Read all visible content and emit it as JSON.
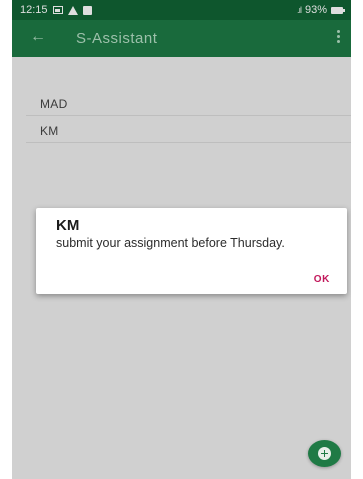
{
  "status_bar": {
    "time": "12:15",
    "left_icons": [
      "image-icon",
      "warning-icon",
      "message-icon"
    ],
    "signal": ".ıl",
    "battery_text": "93%"
  },
  "app_bar": {
    "back_icon": "arrow-back-icon",
    "title": "S-Assistant",
    "overflow_icon": "more-vert-icon"
  },
  "list": {
    "items": [
      {
        "label": "MAD"
      },
      {
        "label": "KM"
      }
    ]
  },
  "dialog": {
    "title": "KM",
    "message": "submit your assignment before Thursday.",
    "ok_label": "OK"
  },
  "fab": {
    "icon": "add-circle-icon"
  },
  "colors": {
    "status_bar": "#0f5a2f",
    "app_bar": "#1b6f3f",
    "content_bg": "#d9d9d9",
    "dialog_bg": "#ffffff",
    "ok_accent": "#c2185b",
    "fab": "#1f7a45"
  }
}
